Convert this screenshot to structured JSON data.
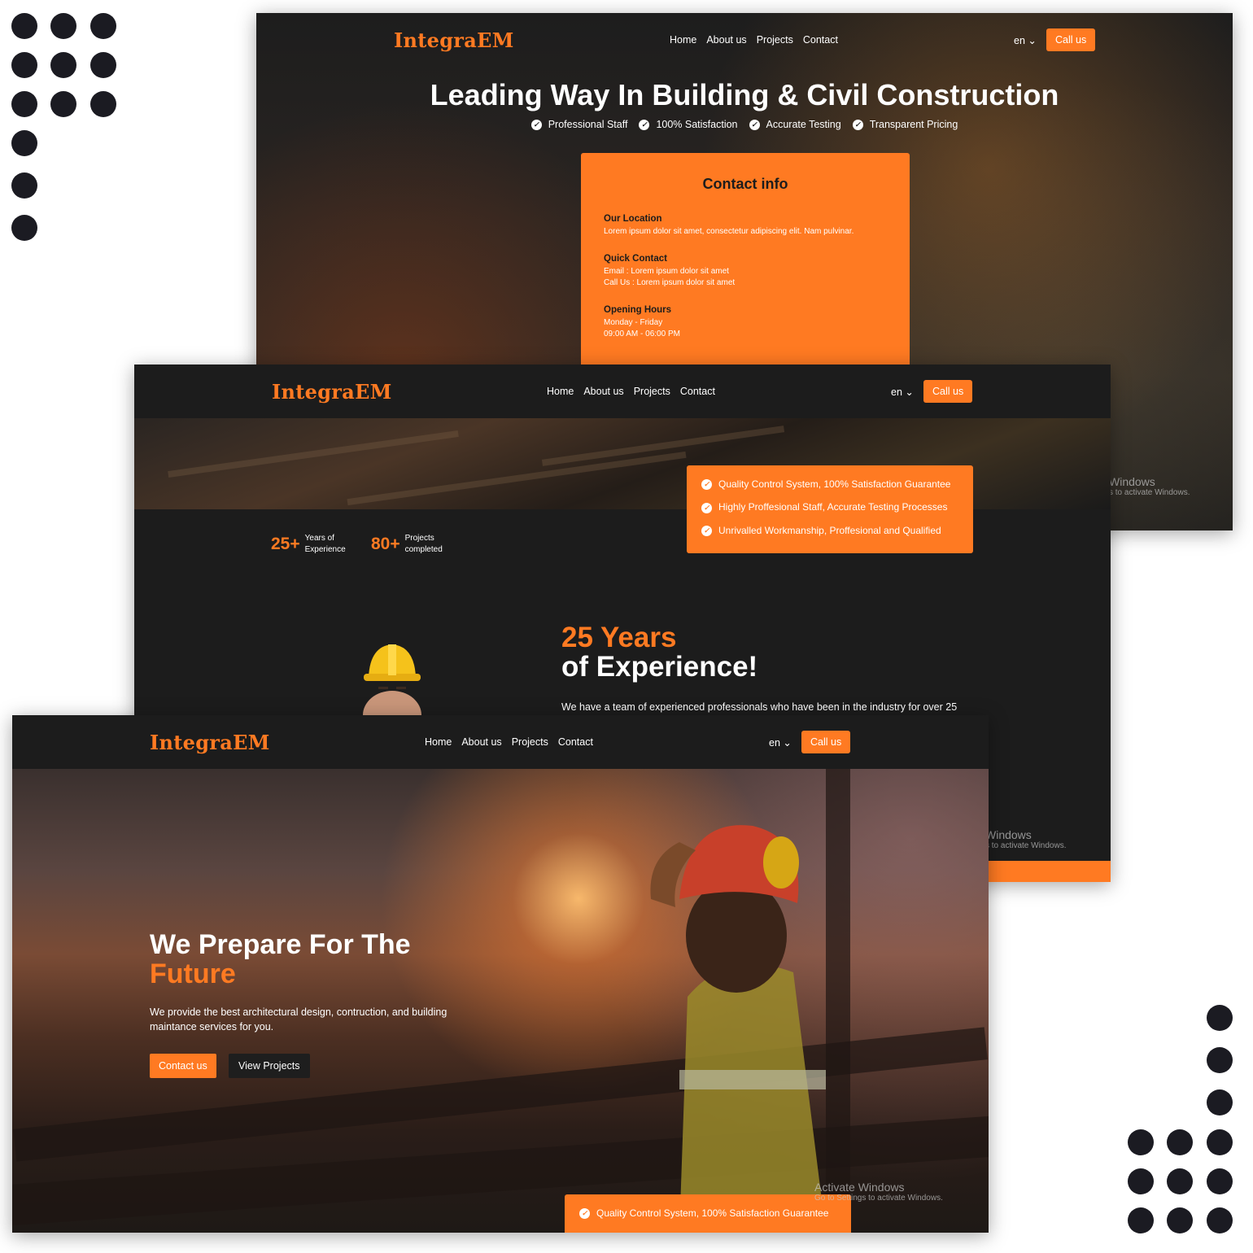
{
  "brand": {
    "logo": "IntegraEM",
    "accent": "#ff7a22",
    "dark": "#1c1c1c"
  },
  "nav": {
    "items": [
      "Home",
      "About us",
      "Projects",
      "Contact"
    ],
    "lang": "en ⌄",
    "call_label": "Call us"
  },
  "contact_page": {
    "title": "Leading Way In Building & Civil Construction",
    "bullets": [
      "Professional Staff",
      "100% Satisfaction",
      "Accurate Testing",
      "Transparent Pricing"
    ],
    "card_title": "Contact info",
    "location_label": "Our Location",
    "location_text": "Lorem ipsum dolor sit amet, consectetur adipiscing elit. Nam pulvinar.",
    "quick_label": "Quick Contact",
    "email_text": "Email : Lorem ipsum dolor sit amet",
    "call_text": "Call Us : Lorem ipsum dolor sit amet",
    "hours_label": "Opening Hours",
    "days_text": "Monday - Friday",
    "time_text": "09:00 AM - 06:00 PM"
  },
  "windows_watermark": {
    "line1": "Windows",
    "line2": "s to activate Windows.",
    "full1": "Activate Windows",
    "full2": "Go to Settings to activate Windows."
  },
  "about_page": {
    "quality": [
      "Quality Control System, 100% Satisfaction Guarantee",
      "Highly Proffesional Staff, Accurate Testing Processes",
      "Unrivalled Workmanship, Proffesional and Qualified"
    ],
    "stat1_num": "25+",
    "stat1_line1": "Years of",
    "stat1_line2": "Experience",
    "stat2_num": "80+",
    "stat2_line1": "Projects",
    "stat2_line2": "completed",
    "exp_title_orange": "25 Years",
    "exp_title_white": "of Experience!",
    "exp_text": "We have a team of experienced professionals who have been in the industry for over 25"
  },
  "home_page": {
    "title_white": "We Prepare For The",
    "title_orange": "Future",
    "subtitle": "We provide the best architectural design, contruction, and building maintance services for you.",
    "primary_button": "Contact us",
    "secondary_button": "View Projects",
    "quality_bar": "Quality Control System, 100% Satisfaction Guarantee"
  }
}
